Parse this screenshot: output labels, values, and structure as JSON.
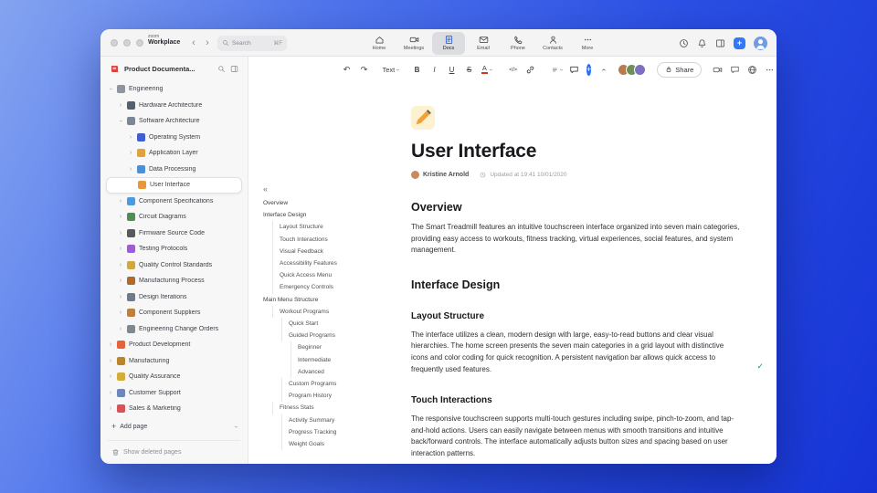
{
  "titlebar": {
    "logo_top": "zoom",
    "logo_bottom": "Workplace",
    "search": {
      "placeholder": "Search",
      "shortcut": "⌘F"
    },
    "tabs": [
      {
        "id": "home",
        "label": "Home",
        "active": false
      },
      {
        "id": "meetings",
        "label": "Meetings",
        "active": false
      },
      {
        "id": "docs",
        "label": "Docs",
        "active": true
      },
      {
        "id": "email",
        "label": "Email",
        "active": false
      },
      {
        "id": "phone",
        "label": "Phone",
        "active": false
      },
      {
        "id": "contacts",
        "label": "Contacts",
        "active": false
      },
      {
        "id": "more",
        "label": "More",
        "active": false
      }
    ],
    "right_icons": [
      "clock",
      "bell",
      "panel"
    ]
  },
  "sidebar": {
    "workspace_label": "Product Documenta...",
    "tree": [
      {
        "label": "Engineering",
        "level": 0,
        "chevron": "down",
        "color": "#8e959e"
      },
      {
        "label": "Hardware Architecture",
        "level": 1,
        "chevron": "right",
        "color": "#55606e"
      },
      {
        "label": "Software Architecture",
        "level": 1,
        "chevron": "down",
        "color": "#7c8796"
      },
      {
        "label": "Operating System",
        "level": 2,
        "chevron": "right",
        "color": "#3f5fd0"
      },
      {
        "label": "Application Layer",
        "level": 2,
        "chevron": "right",
        "color": "#e2a23b"
      },
      {
        "label": "Data Processing",
        "level": 2,
        "chevron": "right",
        "color": "#4a90d9"
      },
      {
        "label": "User Interface",
        "level": 2,
        "chevron": "none",
        "color": "#e8973c",
        "selected": true
      },
      {
        "label": "Component Specifications",
        "level": 1,
        "chevron": "right",
        "color": "#4a9be0"
      },
      {
        "label": "Circuit Diagrams",
        "level": 1,
        "chevron": "right",
        "color": "#4f8f4f"
      },
      {
        "label": "Firmware Source Code",
        "level": 1,
        "chevron": "right",
        "color": "#5a5a5a"
      },
      {
        "label": "Testing Protocols",
        "level": 1,
        "chevron": "right",
        "color": "#9a5fd6"
      },
      {
        "label": "Quality Control Standards",
        "level": 1,
        "chevron": "right",
        "color": "#d2a83c"
      },
      {
        "label": "Manufacturing Process",
        "level": 1,
        "chevron": "right",
        "color": "#b06a2e"
      },
      {
        "label": "Design Iterations",
        "level": 1,
        "chevron": "right",
        "color": "#6e7b8a"
      },
      {
        "label": "Component Suppliers",
        "level": 1,
        "chevron": "right",
        "color": "#c0803a"
      },
      {
        "label": "Engineering Change Orders",
        "level": 1,
        "chevron": "right",
        "color": "#808890"
      },
      {
        "label": "Product Development",
        "level": 0,
        "chevron": "right",
        "color": "#e2633c"
      },
      {
        "label": "Manufacturing",
        "level": 0,
        "chevron": "right",
        "color": "#b8862e"
      },
      {
        "label": "Quality Assurance",
        "level": 0,
        "chevron": "right",
        "color": "#d4ad3a"
      },
      {
        "label": "Customer Support",
        "level": 0,
        "chevron": "right",
        "color": "#6f87b8"
      },
      {
        "label": "Sales & Marketing",
        "level": 0,
        "chevron": "right",
        "color": "#d65454"
      }
    ],
    "add_page_label": "Add page",
    "show_deleted_label": "Show deleted pages"
  },
  "toolbar": {
    "items": [
      "undo",
      "redo",
      "|",
      "text",
      "|",
      "bold",
      "italic",
      "underline",
      "strikethrough",
      "color",
      "|",
      "code",
      "link",
      "|",
      "align",
      "comment",
      "insert",
      "collapse"
    ],
    "text_style_label": "Text",
    "share_label": "Share",
    "editors": [
      "#b97a4e",
      "#6f8f5a",
      "#7d6fc4"
    ],
    "right_icons": [
      "camera",
      "chat",
      "globe",
      "more"
    ],
    "accent_color": "#2a6ff2"
  },
  "outline": {
    "items": [
      {
        "label": "Overview",
        "level": 0
      },
      {
        "label": "Interface Design",
        "level": 0
      },
      {
        "label": "Layout Structure",
        "level": 1
      },
      {
        "label": "Touch Interactions",
        "level": 1
      },
      {
        "label": "Visual Feedback",
        "level": 1
      },
      {
        "label": "Accessibility Features",
        "level": 1
      },
      {
        "label": "Quick Access Menu",
        "level": 1
      },
      {
        "label": "Emergency Controls",
        "level": 1
      },
      {
        "label": "Main Menu Structure",
        "level": 0
      },
      {
        "label": "Workout Programs",
        "level": 1
      },
      {
        "label": "Quick Start",
        "level": 2
      },
      {
        "label": "Guided Programs",
        "level": 2
      },
      {
        "label": "Beginner",
        "level": 3
      },
      {
        "label": "Intermediate",
        "level": 3
      },
      {
        "label": "Advanced",
        "level": 3
      },
      {
        "label": "Custom Programs",
        "level": 2
      },
      {
        "label": "Program History",
        "level": 2
      },
      {
        "label": "Fitness Stats",
        "level": 1
      },
      {
        "label": "Activity Summary",
        "level": 2
      },
      {
        "label": "Progress Tracking",
        "level": 2
      },
      {
        "label": "Weight Goals",
        "level": 2
      }
    ]
  },
  "doc": {
    "title": "User Interface",
    "author": "Kristine Arnold",
    "updated": "Updated at 19:41 10/01/2020",
    "check_color": "#1f9d4d",
    "sections": [
      {
        "type": "h2",
        "text": "Overview"
      },
      {
        "type": "p",
        "text": "The Smart Treadmill features an intuitive touchscreen interface organized into seven main categories, providing easy access to workouts, fitness tracking, virtual experiences, social features, and system management."
      },
      {
        "type": "h2",
        "text": "Interface Design"
      },
      {
        "type": "h3",
        "text": "Layout Structure"
      },
      {
        "type": "p",
        "text": "The interface utilizes a clean, modern design with large, easy-to-read buttons and clear visual hierarchies. The home screen presents the seven main categories in a grid layout with distinctive icons and color coding for quick recognition. A persistent navigation bar allows quick access to frequently used features.",
        "check": true
      },
      {
        "type": "h3",
        "text": "Touch Interactions"
      },
      {
        "type": "p",
        "text": "The responsive touchscreen supports multi-touch gestures including swipe, pinch-to-zoom, and tap-and-hold actions. Users can easily navigate between menus with smooth transitions and intuitive back/forward controls. The interface automatically adjusts button sizes and spacing based on user interaction patterns."
      }
    ]
  }
}
